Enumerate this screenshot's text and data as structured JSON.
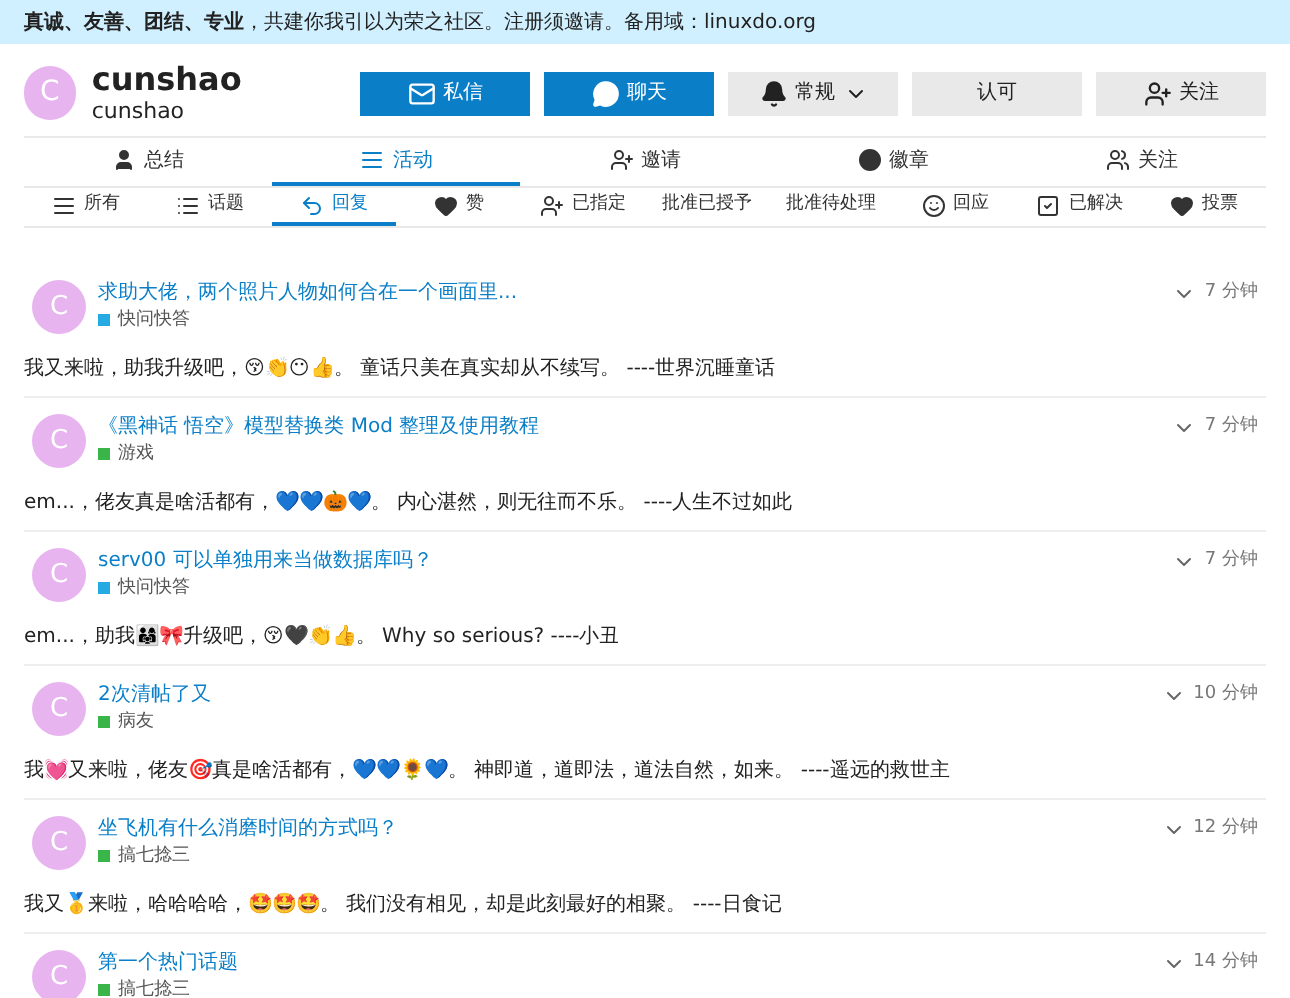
{
  "banner": {
    "text": "**真诚、友善、团结、专业**，共建你我引以为荣之社区。注册须邀请。备用域：linuxdo.org"
  },
  "profile": {
    "avatar_letter": "C",
    "name": "cunshao",
    "username": "cunshao"
  },
  "actions": [
    {
      "kind": "mail",
      "label": "私信",
      "primary": true,
      "dropdown": false
    },
    {
      "kind": "chat",
      "label": "聊天",
      "primary": true,
      "dropdown": false
    },
    {
      "kind": "bell",
      "label": "常规",
      "primary": false,
      "dropdown": true
    },
    {
      "kind": "none",
      "label": "认可",
      "primary": false,
      "dropdown": false
    },
    {
      "kind": "follow",
      "label": "关注",
      "primary": false,
      "dropdown": false
    }
  ],
  "main_tabs": [
    {
      "kind": "user",
      "label": "总结",
      "selected": false
    },
    {
      "kind": "list",
      "label": "活动",
      "selected": true
    },
    {
      "kind": "invite",
      "label": "邀请",
      "selected": false
    },
    {
      "kind": "badge",
      "label": "徽章",
      "selected": false
    },
    {
      "kind": "users",
      "label": "关注",
      "selected": false
    }
  ],
  "sub_tabs": [
    {
      "kind": "list",
      "label": "所有",
      "selected": false
    },
    {
      "kind": "bullets",
      "label": "话题",
      "selected": false
    },
    {
      "kind": "reply",
      "label": "回复",
      "selected": true
    },
    {
      "kind": "heart",
      "label": "赞",
      "selected": false
    },
    {
      "kind": "invite",
      "label": "已指定",
      "selected": false
    },
    {
      "kind": "none",
      "label": "批准已授予",
      "selected": false
    },
    {
      "kind": "none",
      "label": "批准待处理",
      "selected": false
    },
    {
      "kind": "smile",
      "label": "回应",
      "selected": false
    },
    {
      "kind": "check",
      "label": "已解决",
      "selected": false
    },
    {
      "kind": "heart",
      "label": "投票",
      "selected": false
    }
  ],
  "posts": [
    {
      "avatar_letter": "C",
      "title": "求助大佬，两个照片人物如何合在一个画面里...",
      "category": "快问快答",
      "color": "#25aae1",
      "time": "7 分钟",
      "body": "我又来啦，助我升级吧，😚👏😶👍。 童话只美在真实却从不续写。 ----世界沉睡童话"
    },
    {
      "avatar_letter": "C",
      "title": "《黑神话 悟空》模型替换类 Mod 整理及使用教程",
      "category": "游戏",
      "color": "#3ab54a",
      "time": "7 分钟",
      "body": "em...，佬友真是啥活都有，💙💙🎃💙。 内心湛然，则无往而不乐。 ----人生不过如此"
    },
    {
      "avatar_letter": "C",
      "title": "serv00 可以单独用来当做数据库吗？",
      "category": "快问快答",
      "color": "#25aae1",
      "time": "7 分钟",
      "body": "em...，助我👨‍👩‍👧🎀升级吧，😚🖤👏👍。 Why so serious? ----小丑"
    },
    {
      "avatar_letter": "C",
      "title": "2次清帖了又",
      "category": "病友",
      "color": "#3ab54a",
      "time": "10 分钟",
      "body": "我💓又来啦，佬友🎯真是啥活都有，💙💙🌻💙。 神即道，道即法，道法自然，如来。 ----遥远的救世主"
    },
    {
      "avatar_letter": "C",
      "title": "坐飞机有什么消磨时间的方式吗？",
      "category": "搞七捻三",
      "color": "#3ab54a",
      "time": "12 分钟",
      "body": "我又🥇来啦，哈哈哈哈，🤩🤩🤩。 我们没有相见，却是此刻最好的相聚。 ----日食记"
    },
    {
      "avatar_letter": "C",
      "title": "第一个热门话题",
      "category": "搞七捻三",
      "color": "#3ab54a",
      "time": "14 分钟"
    }
  ]
}
